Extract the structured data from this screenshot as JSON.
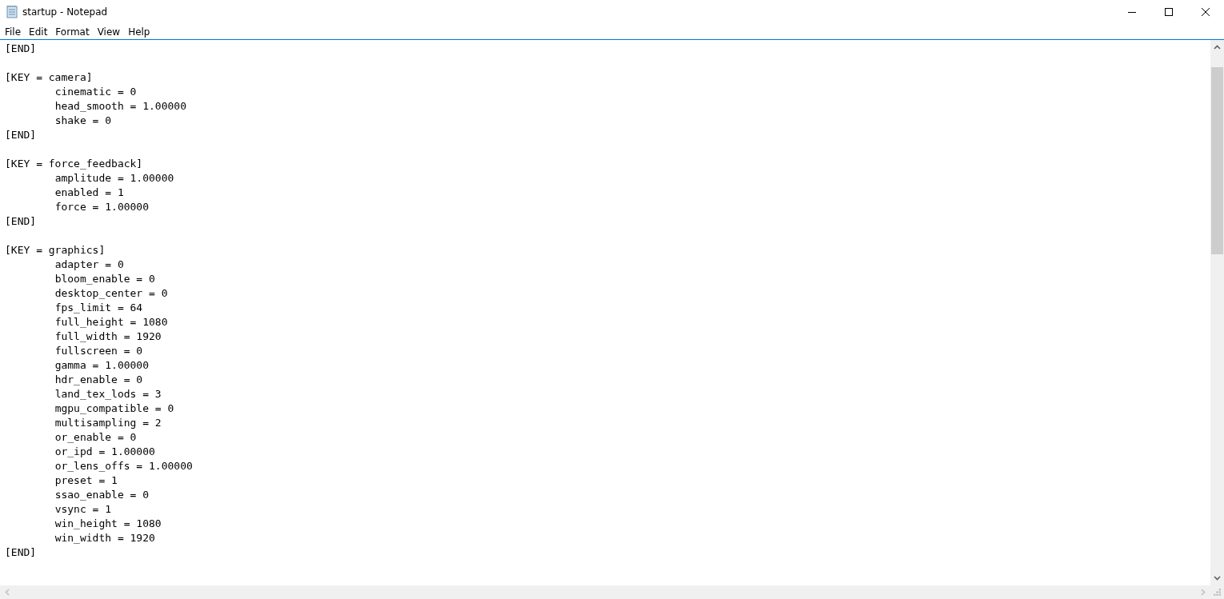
{
  "window": {
    "title": "startup - Notepad"
  },
  "menu": [
    {
      "label": "File"
    },
    {
      "label": "Edit"
    },
    {
      "label": "Format"
    },
    {
      "label": "View"
    },
    {
      "label": "Help"
    }
  ],
  "document": {
    "blocks": [
      {
        "lines": [
          "[END]"
        ]
      },
      {
        "lines": [
          "[KEY = camera]",
          "\tcinematic = 0",
          "\thead_smooth = 1.00000",
          "\tshake = 0",
          "[END]"
        ]
      },
      {
        "lines": [
          "[KEY = force_feedback]",
          "\tamplitude = 1.00000",
          "\tenabled = 1",
          "\tforce = 1.00000",
          "[END]"
        ]
      },
      {
        "lines": [
          "[KEY = graphics]",
          "\tadapter = 0",
          "\tbloom_enable = 0",
          "\tdesktop_center = 0",
          "\tfps_limit = 64",
          "\tfull_height = 1080",
          "\tfull_width = 1920",
          "\tfullscreen = 0",
          "\tgamma = 1.00000",
          "\thdr_enable = 0",
          "\tland_tex_lods = 3",
          "\tmgpu_compatible = 0",
          "\tmultisampling = 2",
          "\tor_enable = 0",
          "\tor_ipd = 1.00000",
          "\tor_lens_offs = 1.00000",
          "\tpreset = 1",
          "\tssao_enable = 0",
          "\tvsync = 1",
          "\twin_height = 1080",
          "\twin_width = 1920",
          "[END]"
        ]
      }
    ]
  }
}
